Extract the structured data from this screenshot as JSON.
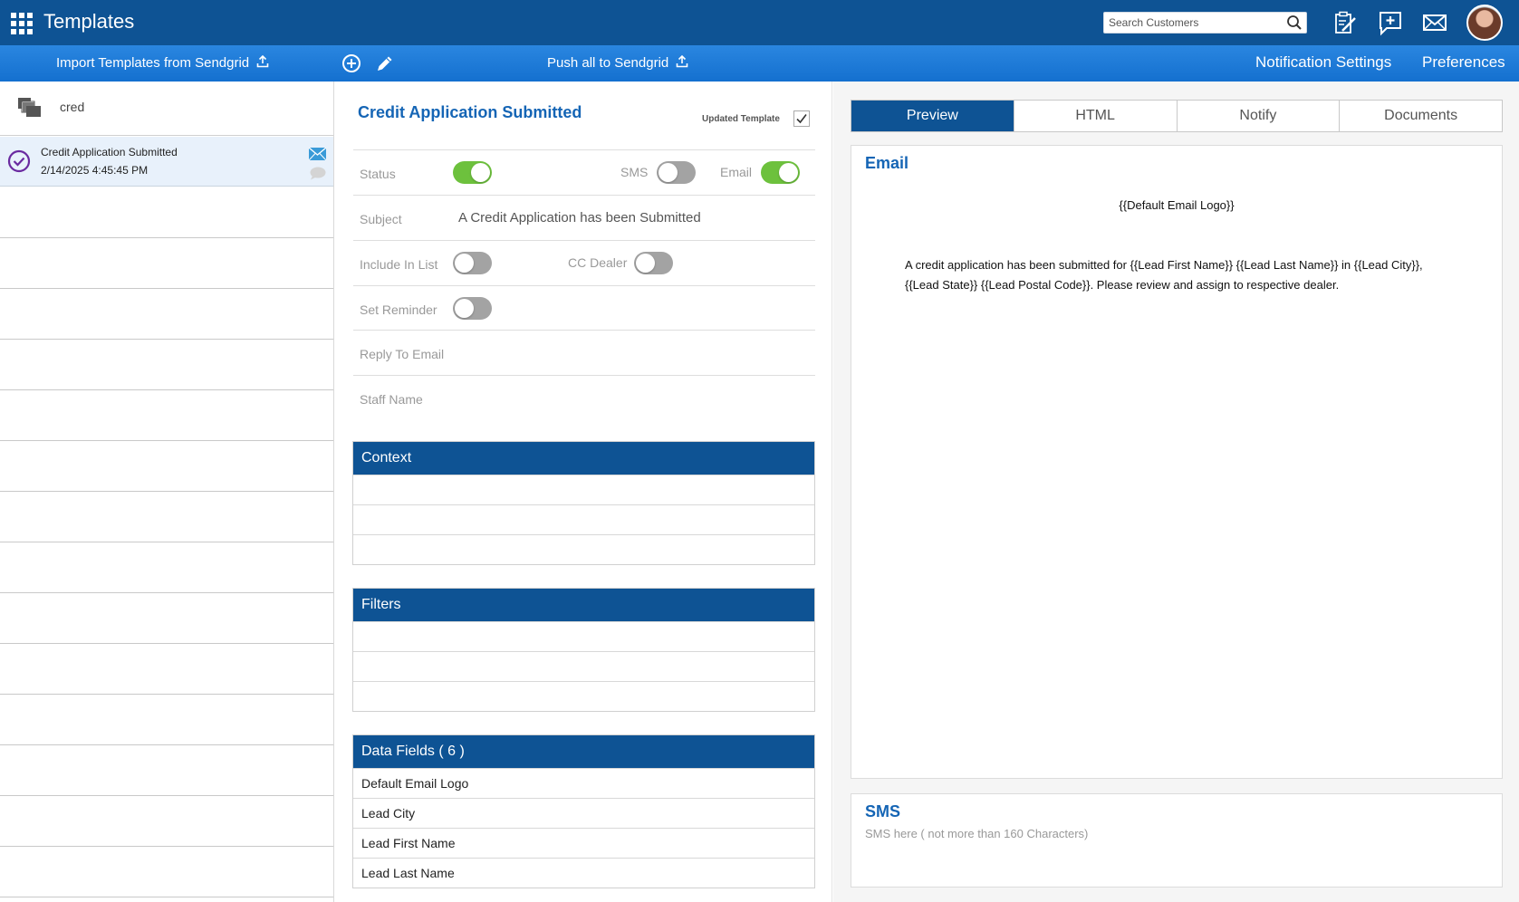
{
  "header": {
    "title": "Templates",
    "search_placeholder": "Search Customers"
  },
  "subbar": {
    "import_label": "Import Templates from Sendgrid",
    "push_label": "Push all to Sendgrid",
    "notification_settings": "Notification Settings",
    "preferences": "Preferences"
  },
  "sidebar": {
    "filter_value": "cred",
    "items": [
      {
        "name": "Credit Application Submitted",
        "date": "2/14/2025 4:45:45 PM"
      }
    ]
  },
  "detail": {
    "title": "Credit Application Submitted",
    "updated_label": "Updated Template",
    "updated_checked": true,
    "status_label": "Status",
    "status_on": true,
    "sms_label": "SMS",
    "sms_on": false,
    "email_label": "Email",
    "email_on": true,
    "subject_label": "Subject",
    "subject_value": "A Credit Application has been Submitted",
    "include_label": "Include In List",
    "include_on": false,
    "cc_label": "CC Dealer",
    "cc_on": false,
    "reminder_label": "Set Reminder",
    "reminder_on": false,
    "reply_label": "Reply To Email",
    "staff_label": "Staff Name"
  },
  "context": {
    "title": "Context"
  },
  "filters": {
    "title": "Filters"
  },
  "data_fields": {
    "title": "Data Fields ( 6 )",
    "items": [
      "Default Email Logo",
      "Lead City",
      "Lead First Name",
      "Lead Last Name"
    ]
  },
  "tabs": [
    "Preview",
    "HTML",
    "Notify",
    "Documents"
  ],
  "active_tab": "Preview",
  "preview": {
    "email_title": "Email",
    "logo_placeholder": "{{Default Email Logo}}",
    "body": "A credit application has been submitted for {{Lead First Name}} {{Lead Last Name}} in {{Lead City}}, {{Lead State}} {{Lead Postal Code}}. Please review and assign to respective dealer.",
    "sms_title": "SMS",
    "sms_hint": "SMS here ( not more than 160 Characters)"
  },
  "colors": {
    "header_bg": "#0e5394",
    "subbar_bg": "#1a78d6",
    "accent_blue": "#1565b5",
    "toggle_on": "#6dc13d",
    "toggle_off": "#a3a3a3",
    "selected_item_bg": "#e8f1fb"
  }
}
